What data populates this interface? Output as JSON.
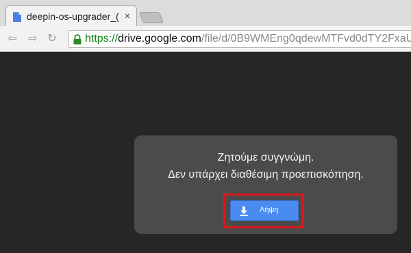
{
  "tab": {
    "title": "deepin-os-upgrader_(",
    "close_glyph": "×",
    "favicon": "document-icon"
  },
  "toolbar": {
    "back_glyph": "⇦",
    "forward_glyph": "⇨",
    "reload_glyph": "↻",
    "url_scheme": "https://",
    "url_host": "drive.google.com",
    "url_path": "/file/d/0B9WMEng0qdewMTFvd0dTY2FxaU"
  },
  "dialog": {
    "line1": "Ζητούμε συγγνώμη.",
    "line2": "Δεν υπάρχει διαθέσιμη προεπισκόπηση.",
    "download_label": "Λήψη"
  },
  "colors": {
    "page_bg": "#262626",
    "dialog_bg": "#4b4b4b",
    "button_blue": "#4a8bf2",
    "highlight_red": "#e0151a",
    "secure_green": "#108010"
  }
}
